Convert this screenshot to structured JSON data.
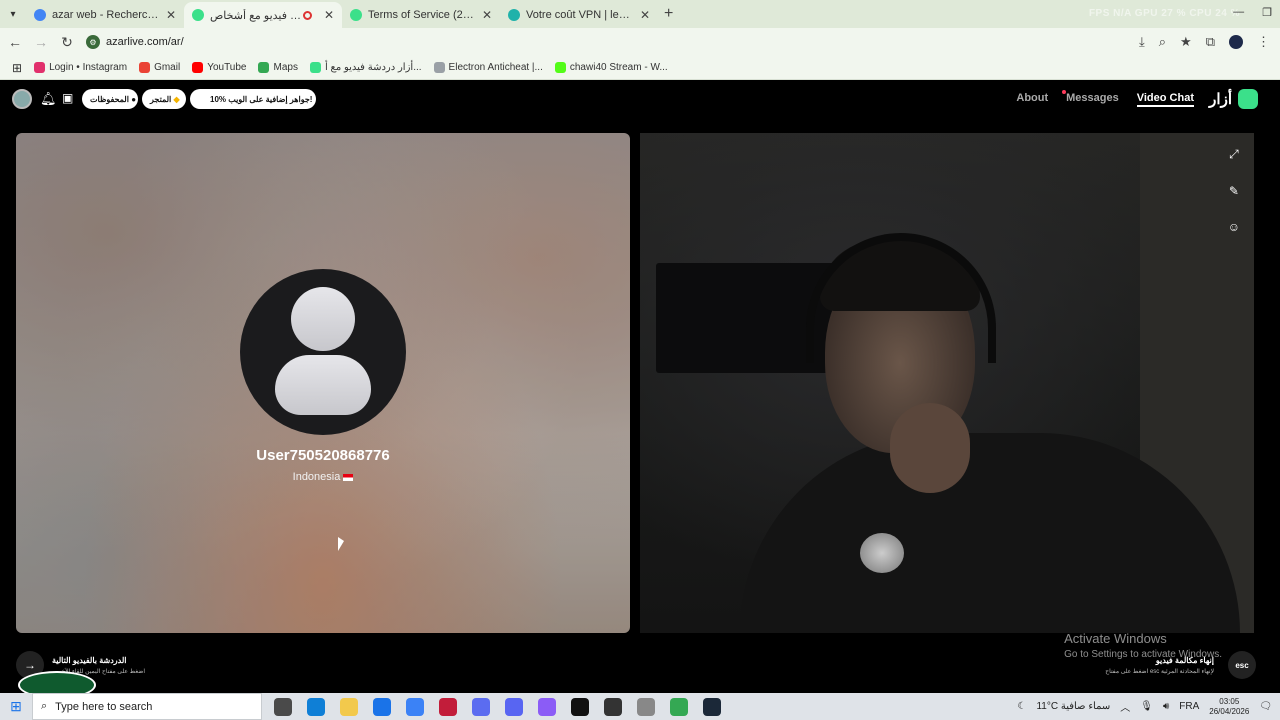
{
  "browser": {
    "tabs": [
      {
        "title": "azar web - Recherche Google",
        "active": false,
        "color": "#4285f4"
      },
      {
        "title": "أزار دردشة فيديو مع أشخاص",
        "active": true,
        "color": "#3be08a"
      },
      {
        "title": "Terms of Service (2026-02-01)",
        "active": false,
        "color": "#3be08a"
      },
      {
        "title": "Votre coût VPN | les plans tarif",
        "active": false,
        "color": "#20b2aa"
      }
    ],
    "perf_overlay": "FPS N/A   GPU 27 %   CPU 24 %",
    "url": "azarlive.com/ar/",
    "bookmarks": [
      {
        "label": "Login • Instagram",
        "color": "#e1306c"
      },
      {
        "label": "Gmail",
        "color": "#ea4335"
      },
      {
        "label": "YouTube",
        "color": "#ff0000"
      },
      {
        "label": "Maps",
        "color": "#34a853"
      },
      {
        "label": "أزار دردشة فيديو مع أ...",
        "color": "#3be08a"
      },
      {
        "label": "Electron Anticheat |...",
        "color": "#9aa0a6"
      },
      {
        "label": "chawi40 Stream - W...",
        "color": "#53fc18"
      }
    ]
  },
  "site": {
    "pill_saved": "المحفوظات",
    "pill_store": "المتجر",
    "pill_promo": "10% جواهر إضافية على الويب!",
    "nav": {
      "about": "About",
      "messages": "Messages",
      "video_chat": "Video Chat"
    },
    "brand": "أزار"
  },
  "partner": {
    "username": "User750520868776",
    "country": "Indonesia"
  },
  "hints": {
    "left_title": "الدردشة بالفيديو التالية",
    "left_sub": "اضغط على مفتاح اليمين للقاء الآخرين",
    "right_title": "إنهاء مكالمة فيديو",
    "right_sub": "اضغط على مفتاح esc لإنهاء المحادثة المرئية",
    "esc": "esc"
  },
  "windows_watermark": {
    "title": "Activate Windows",
    "subtitle": "Go to Settings to activate Windows."
  },
  "taskbar": {
    "search_placeholder": "Type here to search",
    "weather": "11°C  سماء صافية",
    "lang": "FRA",
    "time": "03:05",
    "date": "26/04/2026"
  }
}
